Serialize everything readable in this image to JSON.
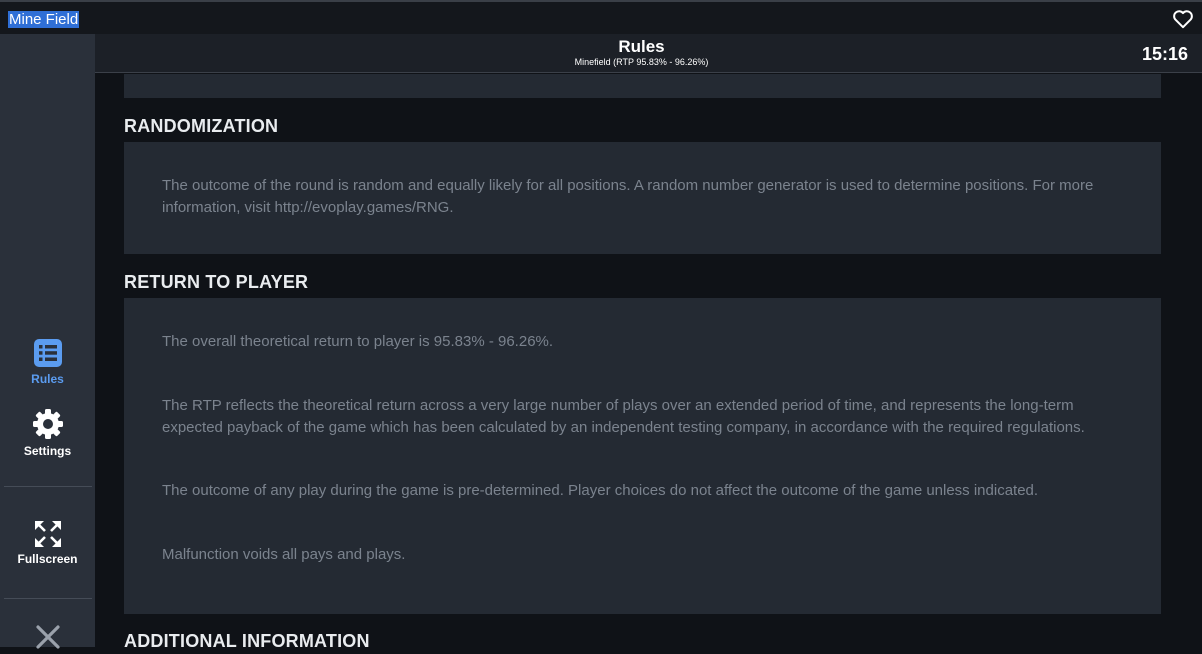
{
  "window": {
    "title": "Mine Field"
  },
  "header": {
    "title": "Rules",
    "subtitle": "Minefield (RTP 95.83% - 96.26%)",
    "time": "15:16"
  },
  "sidebar": {
    "items": [
      {
        "label": "Rules",
        "icon": "list-icon",
        "active": true
      },
      {
        "label": "Settings",
        "icon": "gear-icon"
      },
      {
        "label": "Fullscreen",
        "icon": "fullscreen-icon"
      },
      {
        "label": "",
        "icon": "close-icon"
      }
    ]
  },
  "sections": [
    {
      "title": "RANDOMIZATION",
      "paragraphs": [
        "The outcome of the round is random and equally likely for all positions. A random number generator is used to determine positions. For more information, visit http://evoplay.games/RNG."
      ]
    },
    {
      "title": "RETURN TO PLAYER",
      "paragraphs": [
        "The overall theoretical return to player is 95.83% - 96.26%.",
        "The RTP reflects the theoretical return across a very large number of plays over an extended period of time, and represents the long-term expected payback of the game which has been calculated by an independent testing company, in accordance with the required regulations.",
        "The outcome of any play during the game is pre-determined. Player choices do not affect the outcome of the game unless indicated.",
        "Malfunction voids all pays and plays."
      ]
    },
    {
      "title": "ADDITIONAL INFORMATION"
    }
  ],
  "colors": {
    "accent": "#5b9cf0",
    "panel": "#242a33",
    "background": "#0f1217",
    "sidebar": "#2a303a"
  }
}
